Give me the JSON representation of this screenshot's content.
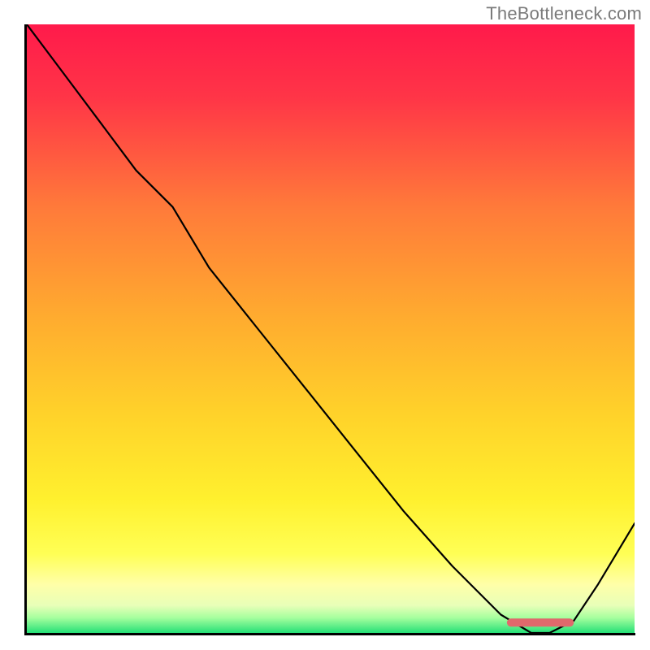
{
  "attribution": "TheBottleneck.com",
  "chart_data": {
    "type": "line",
    "title": "",
    "xlabel": "",
    "ylabel": "",
    "xlim": [
      0,
      100
    ],
    "ylim": [
      0,
      100
    ],
    "x": [
      0,
      6,
      12,
      18,
      24,
      30,
      38,
      46,
      54,
      62,
      70,
      78,
      83,
      86,
      90,
      94,
      100
    ],
    "values": [
      100,
      92,
      84,
      76,
      70,
      60,
      50,
      40,
      30,
      20,
      11,
      3,
      0,
      0,
      2,
      8,
      18
    ],
    "gradient_stops": [
      {
        "pos": 0.0,
        "color": "#ff1a4b"
      },
      {
        "pos": 0.12,
        "color": "#ff3547"
      },
      {
        "pos": 0.3,
        "color": "#ff7a3a"
      },
      {
        "pos": 0.48,
        "color": "#ffab2f"
      },
      {
        "pos": 0.64,
        "color": "#ffd22a"
      },
      {
        "pos": 0.78,
        "color": "#fff02e"
      },
      {
        "pos": 0.87,
        "color": "#ffff55"
      },
      {
        "pos": 0.92,
        "color": "#ffffa8"
      },
      {
        "pos": 0.955,
        "color": "#e8ffb8"
      },
      {
        "pos": 0.975,
        "color": "#a6ff9e"
      },
      {
        "pos": 1.0,
        "color": "#25e077"
      }
    ],
    "marker": {
      "x_start": 79,
      "x_end": 90,
      "y": 1.7,
      "color": "#e0696c"
    }
  }
}
